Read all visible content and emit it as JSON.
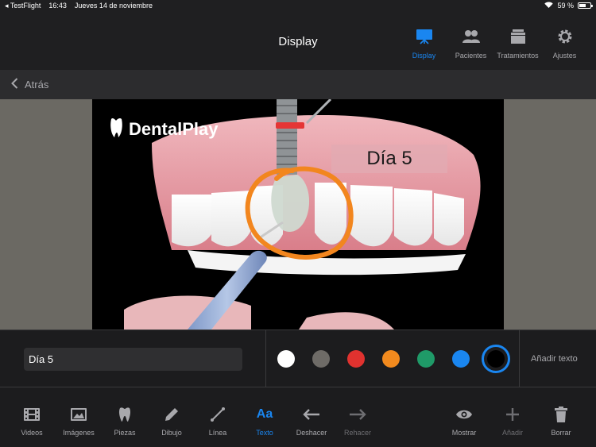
{
  "status": {
    "app": "TestFlight",
    "time": "16:43",
    "date": "Jueves 14 de noviembre",
    "battery": "59 %",
    "battery_level": 0.59
  },
  "nav": {
    "title": "Display",
    "tabs": [
      {
        "label": "Display",
        "icon": "projector-icon",
        "active": true
      },
      {
        "label": "Pacientes",
        "icon": "patients-icon"
      },
      {
        "label": "Tratamientos",
        "icon": "stack-icon"
      },
      {
        "label": "Ajustes",
        "icon": "gear-icon"
      }
    ]
  },
  "back": {
    "label": "Atrás"
  },
  "canvas": {
    "logo": "DentalPlay",
    "overlay_text": "Día 5"
  },
  "controls": {
    "text_value": "Día 5",
    "colors": [
      "#ffffff",
      "#6e6b67",
      "#e0322f",
      "#f28a1e",
      "#1f9a68",
      "#1a86f0",
      "#000000"
    ],
    "selected_color": "#000000",
    "add_text_label": "Añadir texto"
  },
  "toolbar": {
    "videos": "Videos",
    "imagenes": "Imágenes",
    "piezas": "Piezas",
    "dibujo": "Dibujo",
    "linea": "Línea",
    "texto_icon": "Aa",
    "texto": "Texto",
    "deshacer": "Deshacer",
    "rehacer": "Rehacer",
    "mostrar": "Mostrar",
    "anadir": "Añadir",
    "borrar": "Borrar"
  }
}
